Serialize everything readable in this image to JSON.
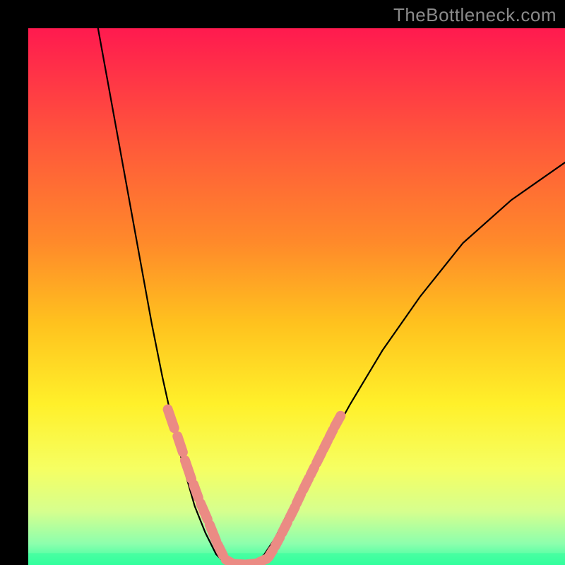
{
  "watermark": "TheBottleneck.com",
  "chart_data": {
    "type": "line",
    "title": "",
    "xlabel": "",
    "ylabel": "",
    "xlim": [
      0,
      100
    ],
    "ylim": [
      0,
      100
    ],
    "gradient_stops": [
      {
        "offset": 0.0,
        "color": "#ff1a4f"
      },
      {
        "offset": 0.22,
        "color": "#ff5a3a"
      },
      {
        "offset": 0.4,
        "color": "#ff8a2a"
      },
      {
        "offset": 0.55,
        "color": "#ffc21e"
      },
      {
        "offset": 0.7,
        "color": "#fff02a"
      },
      {
        "offset": 0.82,
        "color": "#f6ff62"
      },
      {
        "offset": 0.9,
        "color": "#d6ff8e"
      },
      {
        "offset": 0.96,
        "color": "#8dffad"
      },
      {
        "offset": 1.0,
        "color": "#2dffa0"
      }
    ],
    "series": [
      {
        "name": "curve-left",
        "style": "black-thin",
        "x": [
          13,
          15,
          17,
          19,
          21,
          23,
          25,
          27,
          29,
          31,
          33,
          35,
          37
        ],
        "y": [
          100,
          89,
          78,
          67,
          56,
          45,
          35,
          26,
          18,
          11,
          6,
          2,
          0
        ]
      },
      {
        "name": "curve-right",
        "style": "black-thin",
        "x": [
          42,
          44,
          46,
          48,
          51,
          55,
          60,
          66,
          73,
          81,
          90,
          100
        ],
        "y": [
          0,
          2,
          5,
          9,
          14,
          21,
          30,
          40,
          50,
          60,
          68,
          75
        ]
      },
      {
        "name": "left-dashes",
        "style": "salmon-dash",
        "segments": [
          {
            "x": [
              26.0,
              27.2
            ],
            "y": [
              29.0,
              25.5
            ]
          },
          {
            "x": [
              27.8,
              28.8
            ],
            "y": [
              24.0,
              21.0
            ]
          },
          {
            "x": [
              29.2,
              30.4
            ],
            "y": [
              19.5,
              16.0
            ]
          },
          {
            "x": [
              30.8,
              31.7
            ],
            "y": [
              15.0,
              12.5
            ]
          },
          {
            "x": [
              32.1,
              33.4
            ],
            "y": [
              11.5,
              8.5
            ]
          },
          {
            "x": [
              33.8,
              35.0
            ],
            "y": [
              7.5,
              4.5
            ]
          },
          {
            "x": [
              35.3,
              36.3
            ],
            "y": [
              3.8,
              1.8
            ]
          },
          {
            "x": [
              36.8,
              38.0
            ],
            "y": [
              1.0,
              0.3
            ]
          }
        ]
      },
      {
        "name": "bottom-dashes",
        "style": "salmon-dash",
        "segments": [
          {
            "x": [
              38.5,
              40.2
            ],
            "y": [
              0.2,
              0.1
            ]
          },
          {
            "x": [
              40.7,
              42.5
            ],
            "y": [
              0.1,
              0.3
            ]
          },
          {
            "x": [
              43.0,
              44.5
            ],
            "y": [
              0.5,
              1.2
            ]
          }
        ]
      },
      {
        "name": "right-dashes",
        "style": "salmon-dash",
        "segments": [
          {
            "x": [
              44.8,
              45.6
            ],
            "y": [
              1.5,
              2.8
            ]
          },
          {
            "x": [
              46.0,
              46.9
            ],
            "y": [
              3.5,
              5.2
            ]
          },
          {
            "x": [
              47.3,
              48.3
            ],
            "y": [
              6.0,
              8.0
            ]
          },
          {
            "x": [
              48.7,
              49.7
            ],
            "y": [
              8.8,
              10.8
            ]
          },
          {
            "x": [
              50.0,
              50.8
            ],
            "y": [
              11.5,
              13.2
            ]
          },
          {
            "x": [
              51.2,
              52.3
            ],
            "y": [
              14.0,
              16.2
            ]
          },
          {
            "x": [
              52.6,
              53.3
            ],
            "y": [
              16.8,
              18.2
            ]
          },
          {
            "x": [
              53.7,
              54.7
            ],
            "y": [
              19.0,
              21.0
            ]
          },
          {
            "x": [
              55.0,
              55.8
            ],
            "y": [
              21.6,
              23.2
            ]
          },
          {
            "x": [
              56.1,
              56.8
            ],
            "y": [
              23.8,
              25.2
            ]
          },
          {
            "x": [
              57.1,
              58.2
            ],
            "y": [
              25.8,
              27.8
            ]
          }
        ]
      }
    ],
    "green_band": {
      "y_top": 2.2,
      "y_bottom": 0
    }
  }
}
